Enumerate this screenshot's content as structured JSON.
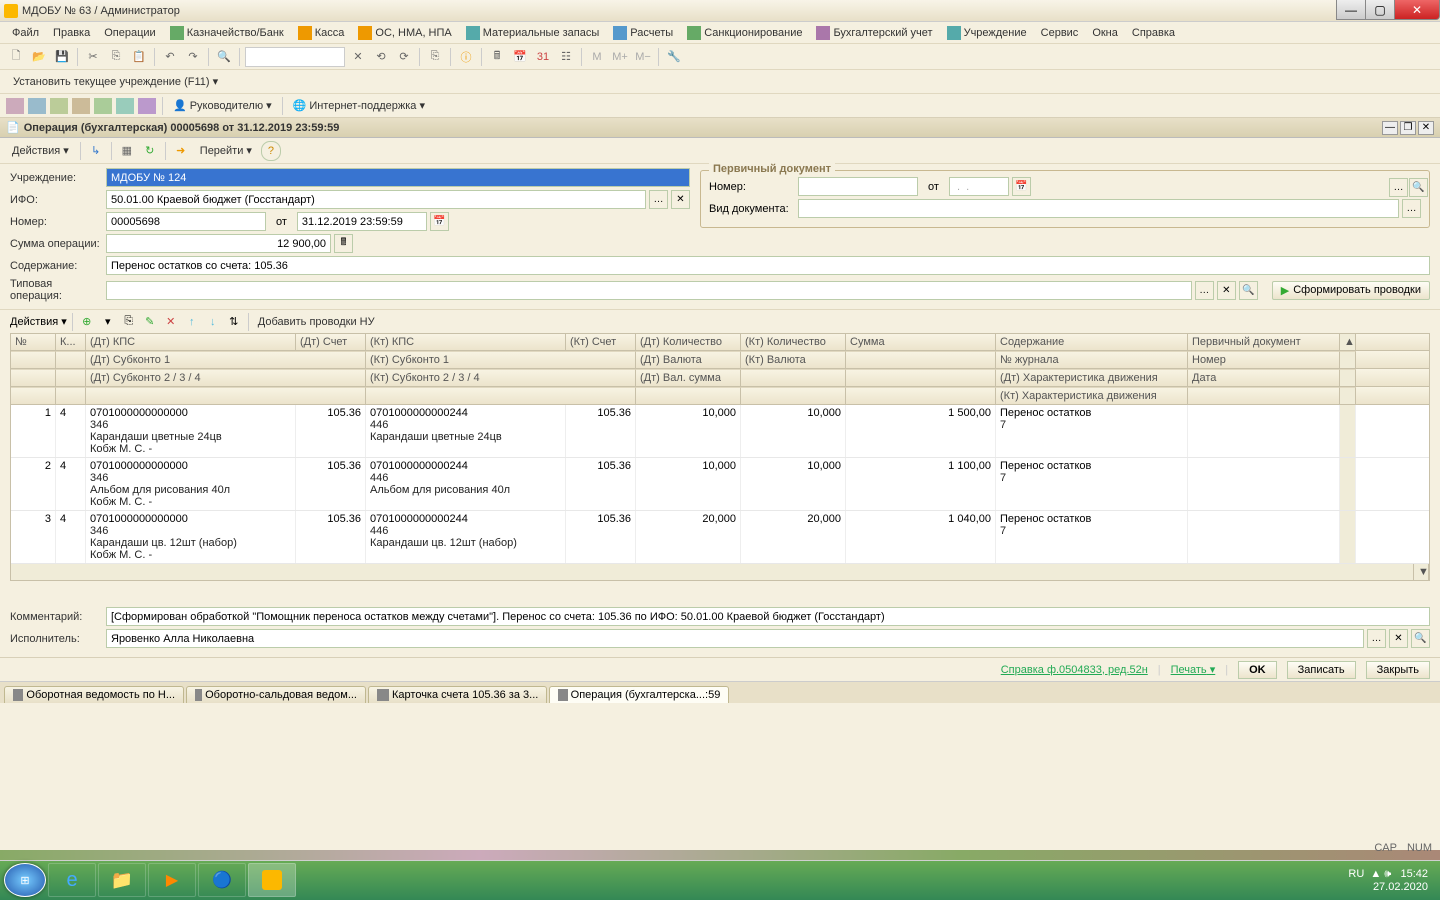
{
  "title_bar": {
    "app": "МДОБУ № 63",
    "sep": " / ",
    "user": "Администратор"
  },
  "menu": {
    "file": "Файл",
    "edit": "Правка",
    "ops": "Операции",
    "treasury": "Казначейство/Банк",
    "kassa": "Касса",
    "os": "ОС, НМА, НПА",
    "mat": "Материальные запасы",
    "calc": "Расчеты",
    "sanc": "Санкционирование",
    "buch": "Бухгалтерский учет",
    "org": "Учреждение",
    "service": "Сервис",
    "windows": "Окна",
    "help": "Справка"
  },
  "toolbar2": {
    "set_current": "Установить текущее учреждение (F11)"
  },
  "toolbar3": {
    "manager": "Руководителю",
    "support": "Интернет-поддержка"
  },
  "doc_title": "Операция (бухгалтерская) 00005698 от 31.12.2019 23:59:59",
  "doc_toolbar": {
    "actions": "Действия",
    "goto": "Перейти"
  },
  "form": {
    "org_label": "Учреждение:",
    "org_value": "МДОБУ № 124",
    "ifo_label": "ИФО:",
    "ifo_value": "50.01.00 Краевой бюджет (Госстандарт)",
    "num_label": "Номер:",
    "num_value": "00005698",
    "from_label": "от",
    "date_value": "31.12.2019 23:59:59",
    "sum_label": "Сумма операции:",
    "sum_value": "12 900,00",
    "content_label": "Содержание:",
    "content_value": "Перенос остатков со счета: 105.36",
    "type_label": "Типовая операция:"
  },
  "primary_doc": {
    "legend": "Первичный документ",
    "num_label": "Номер:",
    "from_label": "от",
    "date_placeholder": " .  .",
    "type_label": "Вид документа:"
  },
  "gen_btn": "Сформировать проводки",
  "grid_toolbar": {
    "actions": "Действия",
    "add_nu": "Добавить проводки НУ"
  },
  "grid": {
    "headers": {
      "n": "№",
      "k": "К...",
      "dt_kps": "(Дт) КПС",
      "dt_schet": "(Дт) Счет",
      "kt_kps": "(Кт) КПС",
      "kt_schet": "(Кт) Счет",
      "dt_qty": "(Дт) Количество",
      "kt_qty": "(Кт) Количество",
      "sum": "Сумма",
      "sod": "Содержание",
      "doc": "Первичный документ"
    },
    "sub1": {
      "dt_sub1": "(Дт) Субконто 1",
      "kt_sub1": "(Кт) Субконто 1",
      "dt_val": "(Дт) Валюта",
      "kt_val": "(Кт) Валюта",
      "journal": "№ журнала",
      "num": "Номер"
    },
    "sub2": {
      "dt_sub234": "(Дт) Субконто 2 / 3 / 4",
      "kt_sub234": "(Кт) Субконто 2 / 3 / 4",
      "dt_vsum": "(Дт) Вал. сумма",
      "dt_char": "(Дт) Характеристика движения",
      "date": "Дата",
      "kt_char": "(Кт) Характеристика движения"
    },
    "rows": [
      {
        "n": "1",
        "k": "4",
        "dt_kps": "0701000000000000",
        "dt_schet": "105.36",
        "kt_kps": "0701000000000244",
        "kt_schet": "105.36",
        "dt_qty": "10,000",
        "kt_qty": "10,000",
        "sum": "1 500,00",
        "sod": "Перенос остатков",
        "journal": "7",
        "dt_sub1": "346",
        "kt_sub1": "446",
        "item": "Карандаши цветные  24цв",
        "mol": "Кобж М. С. -"
      },
      {
        "n": "2",
        "k": "4",
        "dt_kps": "0701000000000000",
        "dt_schet": "105.36",
        "kt_kps": "0701000000000244",
        "kt_schet": "105.36",
        "dt_qty": "10,000",
        "kt_qty": "10,000",
        "sum": "1 100,00",
        "sod": "Перенос остатков",
        "journal": "7",
        "dt_sub1": "346",
        "kt_sub1": "446",
        "item": "Альбом для рисования 40л",
        "mol": "Кобж М. С. -"
      },
      {
        "n": "3",
        "k": "4",
        "dt_kps": "0701000000000000",
        "dt_schet": "105.36",
        "kt_kps": "0701000000000244",
        "kt_schet": "105.36",
        "dt_qty": "20,000",
        "kt_qty": "20,000",
        "sum": "1 040,00",
        "sod": "Перенос остатков",
        "journal": "7",
        "dt_sub1": "346",
        "kt_sub1": "446",
        "item": "Карандаши цв. 12шт (набор)",
        "mol": "Кобж М. С. -"
      }
    ]
  },
  "bottom": {
    "comment_label": "Комментарий:",
    "comment_value": "[Сформирован обработкой \"Помощник переноса остатков между счетами\"]. Перенос со счета: 105.36 по ИФО: 50.01.00 Краевой бюджет (Госстандарт)",
    "exec_label": "Исполнитель:",
    "exec_value": "Яровенко Алла Николаевна"
  },
  "footer": {
    "help": "Справка ф.0504833, ред.52н",
    "print": "Печать",
    "ok": "OK",
    "save": "Записать",
    "close": "Закрыть"
  },
  "tabs": [
    "Оборотная ведомость по Н...",
    "Оборотно-сальдовая ведом...",
    "Карточка счета 105.36 за 3...",
    "Операция (бухгалтерска...:59"
  ],
  "status": {
    "cap": "CAP",
    "num": "NUM"
  },
  "tray": {
    "lang": "RU",
    "time": "15:42",
    "date": "27.02.2020"
  }
}
